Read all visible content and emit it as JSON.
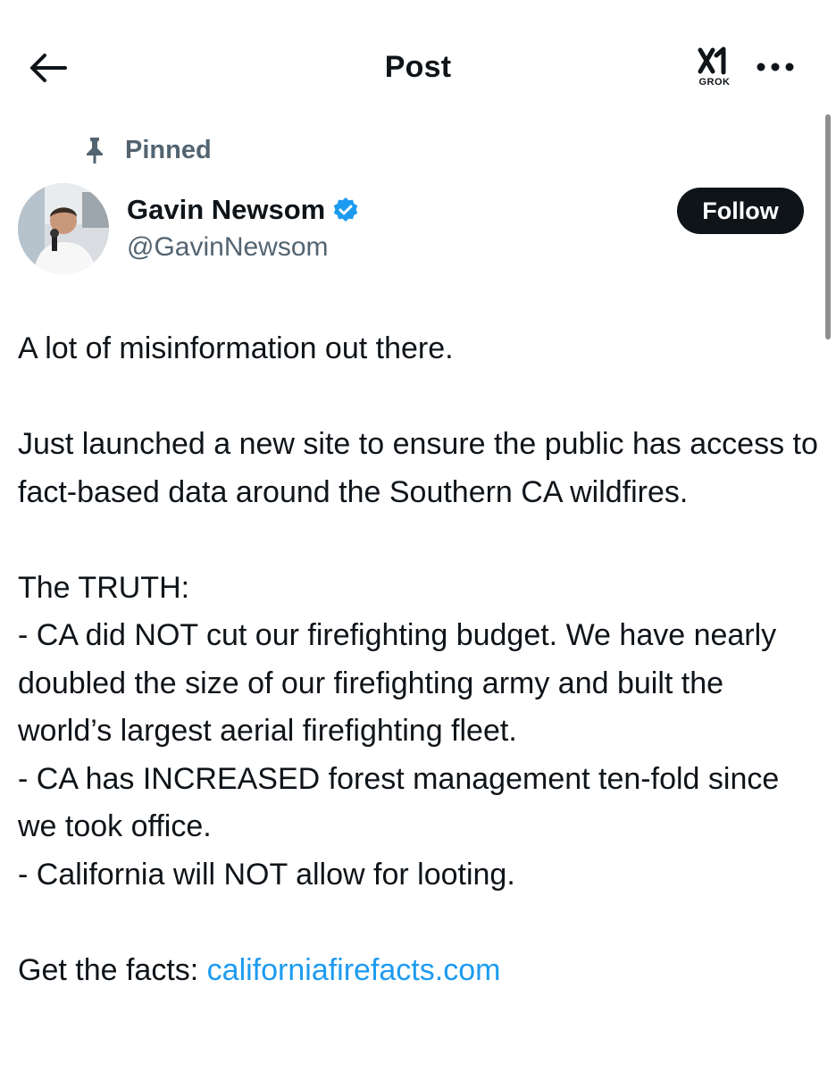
{
  "header": {
    "title": "Post",
    "back_icon": "arrow-left-icon",
    "grok_label": "GROK",
    "more_icon": "more-horizontal-icon"
  },
  "post": {
    "pinned_label": "Pinned",
    "pinned_icon": "pin-icon",
    "author": {
      "name": "Gavin Newsom",
      "handle": "@GavinNewsom",
      "verified_icon": "verified-badge-icon",
      "verified_color": "#1d9bf0"
    },
    "follow_label": "Follow",
    "text": {
      "line1": "A lot of misinformation out there.",
      "para2": "Just launched a new site to ensure the public has access to fact-based data around the Southern CA wildfires.",
      "truth_heading": "The TRUTH:",
      "bullet1": "- CA did NOT cut our firefighting budget. We have nearly doubled the size of our firefighting army and built the world’s largest aerial firefighting fleet.",
      "bullet2": "- CA has INCREASED forest management ten-fold since we took office.",
      "bullet3": "- California will NOT allow for looting.",
      "facts_prefix": "Get the facts: ",
      "facts_link": "californiafirefacts.com"
    }
  },
  "colors": {
    "text": "#0f1419",
    "secondary": "#536471",
    "link": "#1d9bf0",
    "button_bg": "#0f1419"
  }
}
